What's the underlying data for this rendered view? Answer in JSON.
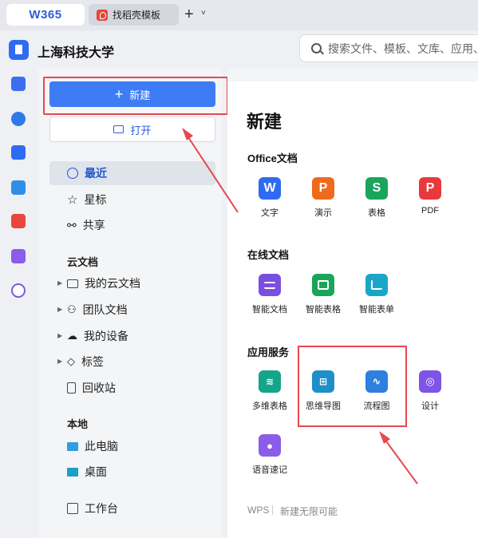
{
  "tabs": {
    "home_label": "W365",
    "doc_tab_label": "找稻壳模板"
  },
  "org": {
    "name": "上海科技大学"
  },
  "search": {
    "placeholder": "搜索文件、模板、文库、应用、"
  },
  "actions": {
    "new_label": "新建",
    "open_label": "打开"
  },
  "nav": {
    "items": [
      {
        "label": "最近",
        "icon": "clock-icon"
      },
      {
        "label": "星标",
        "icon": "star-icon"
      },
      {
        "label": "共享",
        "icon": "share-icon"
      }
    ],
    "cloud_section": "云文档",
    "cloud_items": [
      {
        "label": "我的云文档",
        "icon": "folder-icon"
      },
      {
        "label": "团队文档",
        "icon": "team-icon"
      },
      {
        "label": "我的设备",
        "icon": "cloud-device-icon"
      },
      {
        "label": "标签",
        "icon": "tag-icon"
      },
      {
        "label": "回收站",
        "icon": "trash-icon"
      }
    ],
    "local_section": "本地",
    "local_items": [
      {
        "label": "此电脑",
        "icon": "monitor-icon"
      },
      {
        "label": "桌面",
        "icon": "desktop-icon"
      }
    ],
    "workbench_label": "工作台"
  },
  "main": {
    "title": "新建",
    "office_title": "Office文档",
    "office_apps": [
      {
        "label": "文字",
        "glyph": "W",
        "color": "#2f6bf0"
      },
      {
        "label": "演示",
        "glyph": "P",
        "color": "#f06a1d"
      },
      {
        "label": "表格",
        "glyph": "S",
        "color": "#1aa55a"
      },
      {
        "label": "PDF",
        "glyph": "P",
        "color": "#e8393d"
      }
    ],
    "online_title": "在线文档",
    "online_apps": [
      {
        "label": "智能文档",
        "color": "#7c4ee0"
      },
      {
        "label": "智能表格",
        "color": "#1aa55a"
      },
      {
        "label": "智能表单",
        "color": "#1aa6c8"
      }
    ],
    "services_title": "应用服务",
    "service_apps": [
      {
        "label": "多维表格",
        "color": "#15a58a"
      },
      {
        "label": "思维导图",
        "color": "#1f8fc8"
      },
      {
        "label": "流程图",
        "color": "#2f7fe0"
      },
      {
        "label": "设计",
        "color": "#7d54e6"
      },
      {
        "label": "语音速记",
        "color": "#8b5ce8"
      }
    ],
    "footer_brand": "WPS",
    "footer_slogan": "新建无限可能"
  }
}
